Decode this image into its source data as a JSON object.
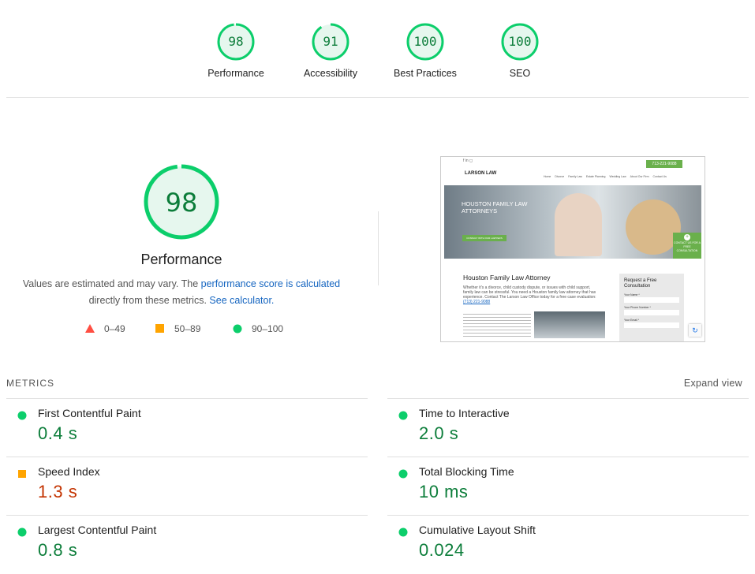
{
  "categories": [
    {
      "score": "98",
      "label": "Performance",
      "fraction": 0.98
    },
    {
      "score": "91",
      "label": "Accessibility",
      "fraction": 0.91
    },
    {
      "score": "100",
      "label": "Best Practices",
      "fraction": 1.0
    },
    {
      "score": "100",
      "label": "SEO",
      "fraction": 1.0
    }
  ],
  "performance": {
    "score": "98",
    "title": "Performance",
    "desc_part1": "Values are estimated and may vary. The ",
    "desc_link1": "performance score is calculated",
    "desc_part2": " directly from these metrics. ",
    "desc_link2": "See calculator.",
    "legend": {
      "fail": "0–49",
      "average": "50–89",
      "pass": "90–100"
    }
  },
  "screenshot": {
    "phone": "713-221-9088",
    "nav": [
      "Home",
      "Divorce",
      "Family Law",
      "Estate Planning",
      "Wedding Law",
      "About Our Firm",
      "Contact Us"
    ],
    "hero_title": "HOUSTON FAMILY LAW ATTORNEYS",
    "hero_button": "CONSULT WITH OUR LAWYERS",
    "cta": "CONTACT US FOR A FREE CONSULTATION",
    "heading": "Houston Family Law Attorney",
    "para": "Whether it's a divorce, child custody dispute, or issues with child support, family law can be stressful. You need a Houston family law attorney that has experience. Contact The Larson Law Office today for a free case evaluation:",
    "phone_link": "(713) 221-9088",
    "form_title": "Request a Free Consultation",
    "form_fields": [
      "Your Name *",
      "Your Phone Number *",
      "Your Email *"
    ],
    "logo": "LARSON LAW"
  },
  "metrics": {
    "section_label": "METRICS",
    "expand": "Expand view",
    "items": [
      {
        "name": "First Contentful Paint",
        "value": "0.4 s",
        "status": "pass"
      },
      {
        "name": "Time to Interactive",
        "value": "2.0 s",
        "status": "pass"
      },
      {
        "name": "Speed Index",
        "value": "1.3 s",
        "status": "average"
      },
      {
        "name": "Total Blocking Time",
        "value": "10 ms",
        "status": "pass"
      },
      {
        "name": "Largest Contentful Paint",
        "value": "0.8 s",
        "status": "pass"
      },
      {
        "name": "Cumulative Layout Shift",
        "value": "0.024",
        "status": "pass"
      }
    ]
  },
  "colors": {
    "pass": "#0cce6b",
    "average": "#ffa400",
    "fail": "#ff4e42",
    "pass_text": "#0c7d3a",
    "average_text": "#c33300"
  }
}
